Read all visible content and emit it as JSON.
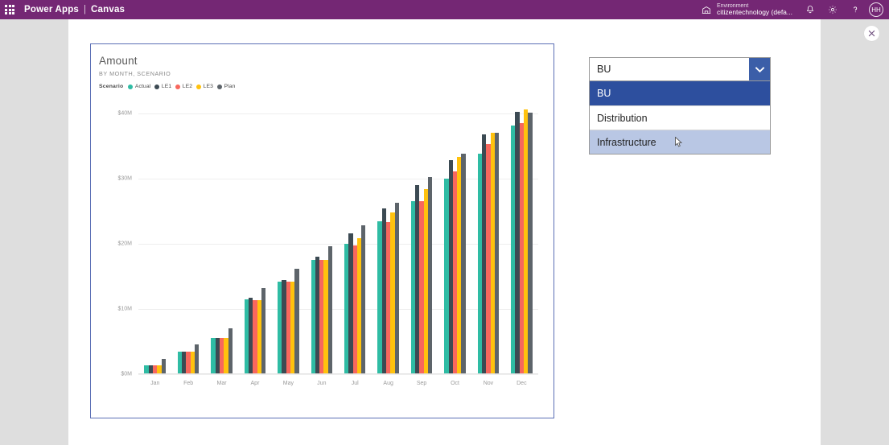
{
  "topbar": {
    "waffle_icon": "app-launcher-icon",
    "app_name": "Power Apps",
    "separator": "|",
    "doc_name": "Canvas",
    "environment": {
      "icon": "environment-icon",
      "label": "Environment",
      "value": "citizentechnology (defa..."
    },
    "notifications_icon": "bell-icon",
    "settings_icon": "gear-icon",
    "help_icon": "question-mark-icon",
    "avatar_initials": "HH",
    "background_color": "#742774"
  },
  "canvas": {
    "close_icon": "close-icon"
  },
  "chart_data": {
    "type": "bar",
    "title": "Amount",
    "subtitle": "BY MONTH, SCENARIO",
    "legend_title": "Scenario",
    "legend_position": "top-left",
    "grid": true,
    "xlabel": "",
    "ylabel": "",
    "ylim": [
      0,
      42
    ],
    "ytick_labels": [
      "$40M",
      "$30M",
      "$20M",
      "$10M",
      "$0M"
    ],
    "ytick_values": [
      40,
      30,
      20,
      10,
      0
    ],
    "categories": [
      "Jan",
      "Feb",
      "Mar",
      "Apr",
      "May",
      "Jun",
      "Jul",
      "Aug",
      "Sep",
      "Oct",
      "Nov",
      "Dec"
    ],
    "series": [
      {
        "name": "Actual",
        "color": "#2fbca4",
        "values": [
          1.3,
          3.4,
          5.5,
          11.5,
          14.2,
          17.6,
          20.0,
          23.5,
          26.5,
          30.0,
          33.8,
          38.2
        ]
      },
      {
        "name": "LE1",
        "color": "#3c4a53",
        "values": [
          1.3,
          3.4,
          5.5,
          11.7,
          14.4,
          18.0,
          21.6,
          25.4,
          29.0,
          32.8,
          36.8,
          40.3
        ]
      },
      {
        "name": "LE2",
        "color": "#f8675d",
        "values": [
          1.3,
          3.4,
          5.5,
          11.4,
          14.2,
          17.6,
          19.8,
          23.3,
          26.5,
          31.1,
          35.3,
          38.6
        ]
      },
      {
        "name": "LE3",
        "color": "#ffc20e",
        "values": [
          1.3,
          3.4,
          5.5,
          11.4,
          14.2,
          17.6,
          20.9,
          24.8,
          28.4,
          33.4,
          37.0,
          40.6
        ]
      },
      {
        "name": "Plan",
        "color": "#5d646a",
        "values": [
          2.3,
          4.6,
          7.0,
          13.2,
          16.2,
          19.6,
          22.9,
          26.3,
          30.3,
          33.8,
          37.1,
          40.1
        ]
      }
    ]
  },
  "dropdown": {
    "selected_value": "BU",
    "chevron_icon": "chevron-down-icon",
    "button_color": "#3b5ea8",
    "options": [
      {
        "label": "BU",
        "state": "selected"
      },
      {
        "label": "Distribution",
        "state": "normal"
      },
      {
        "label": "Infrastructure",
        "state": "hover"
      }
    ]
  }
}
